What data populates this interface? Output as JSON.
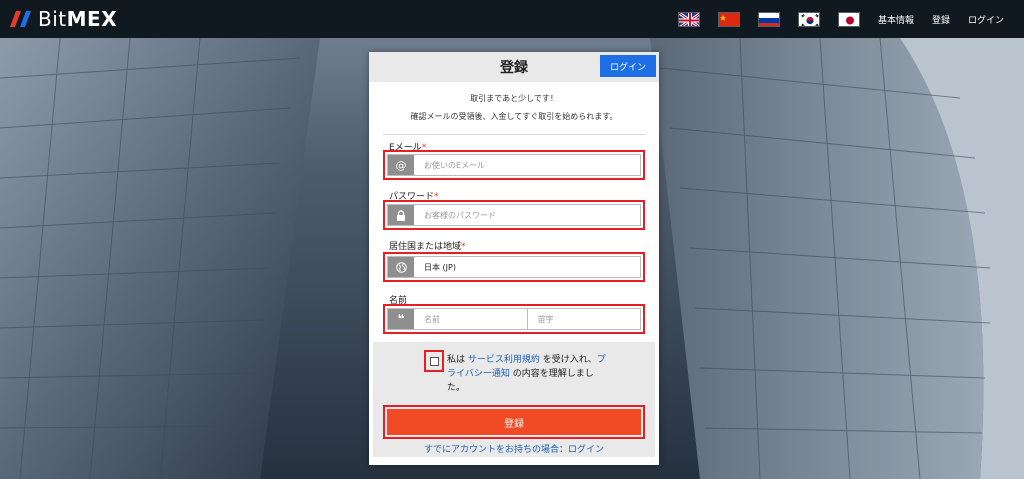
{
  "brand": {
    "name_prefix": "Bit",
    "name_suffix": "MEX",
    "logo_colors": [
      "#e8392a",
      "#1e6fe6"
    ]
  },
  "nav": {
    "flags": [
      {
        "name": "uk-flag-icon"
      },
      {
        "name": "china-flag-icon"
      },
      {
        "name": "russia-flag-icon"
      },
      {
        "name": "korea-flag-icon"
      },
      {
        "name": "japan-flag-icon"
      }
    ],
    "links": [
      "基本情報",
      "登録",
      "ログイン"
    ]
  },
  "form": {
    "title": "登録",
    "header_login": "ログイン",
    "intro_line1": "取引まであと少しです！",
    "intro_line2": "確認メールの受領後、入金してすぐ取引を始められます。",
    "email_label": "Eメール",
    "email_placeholder": "お使いのEメール",
    "password_label": "パスワード",
    "password_placeholder": "お客様のパスワード",
    "country_label": "居住国または地域",
    "country_value": "日本 (JP)",
    "name_label": "名前",
    "first_name_placeholder": "名前",
    "last_name_placeholder": "苗字",
    "required_mark": "*",
    "terms_pre": "私は ",
    "terms_link1": "サービス利用規約",
    "terms_mid": " を受け入れ、",
    "terms_link2": "プライバシー通知",
    "terms_post": " の内容を理解しました。",
    "submit": "登録",
    "already_account": "すでにアカウントをお持ちの場合：ログイン"
  },
  "colors": {
    "accent_blue": "#1e6fe6",
    "submit_orange": "#f04b24",
    "highlight_red": "#e41f25",
    "link_blue": "#1f5fb5"
  }
}
